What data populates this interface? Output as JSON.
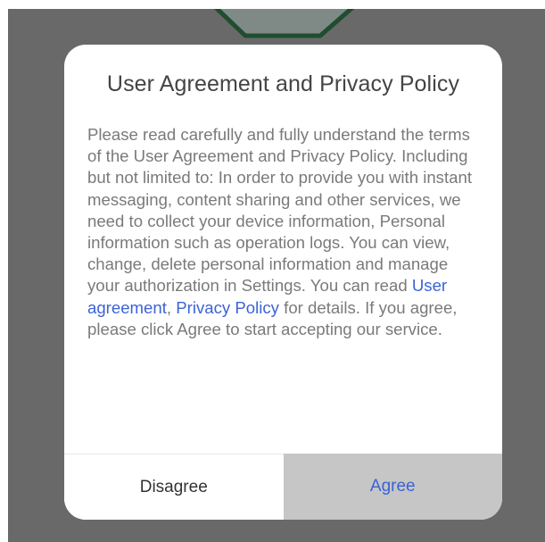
{
  "dialog": {
    "title": "User Agreement and Privacy Policy",
    "body_intro": "Please read carefully and fully understand the terms of the User Agreement and Privacy Policy. Including but not limited to: In order to provide you with instant messaging, content sharing and other services, we need to collect your device information, Personal information such as operation logs. You can view, change, delete personal information and manage your authorization in Settings. You can read ",
    "link_user_agreement": "User agreement",
    "link_separator": ", ",
    "link_privacy_policy": "Privacy Policy",
    "body_outro": " for details. If you agree, please click Agree to start accepting our service.",
    "disagree_label": "Disagree",
    "agree_label": "Agree"
  },
  "colors": {
    "overlay": "#696969",
    "dialog_background": "#ffffff",
    "link": "#3b63d6",
    "agree_background": "#c6c6c6",
    "logo_outline": "#1f4d2e"
  },
  "icons": {
    "app_logo": "app-logo-icon"
  }
}
